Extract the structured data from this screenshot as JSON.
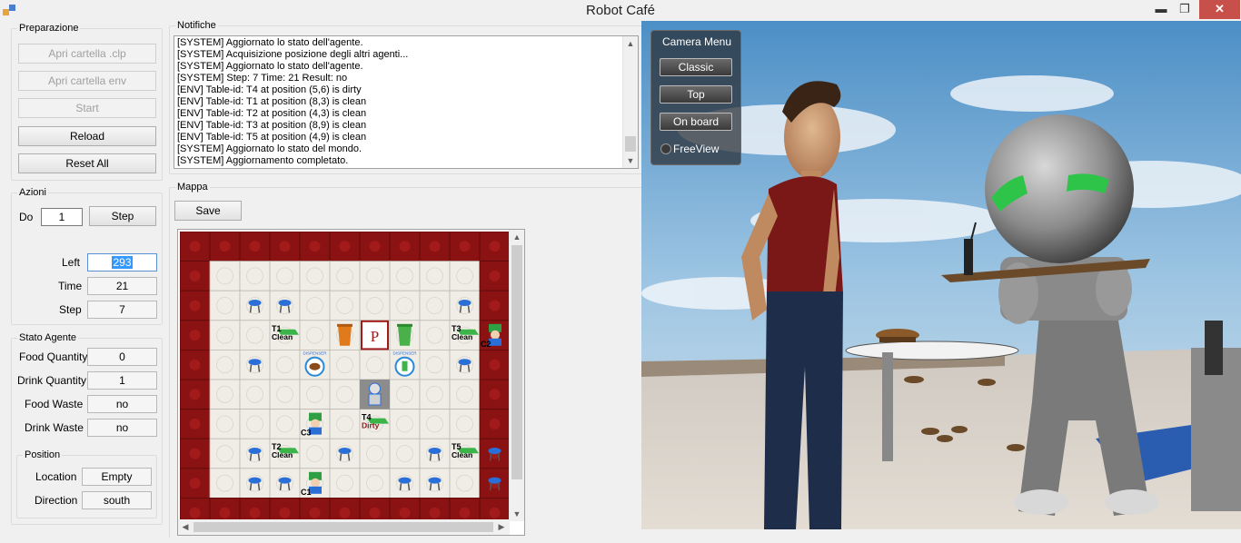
{
  "window": {
    "title": "Robot Café",
    "minimize": "▬",
    "maximize": "❐",
    "close": "✕"
  },
  "preparazione": {
    "legend": "Preparazione",
    "open_clp": "Apri cartella .clp",
    "open_env": "Apri cartella env",
    "start": "Start",
    "reload": "Reload",
    "reset": "Reset All"
  },
  "azioni": {
    "legend": "Azioni",
    "do_label": "Do",
    "do_value": "1",
    "step_button": "Step",
    "left_label": "Left",
    "left_value": "293",
    "time_label": "Time",
    "time_value": "21",
    "step_label": "Step",
    "step_value": "7"
  },
  "stato_agente": {
    "legend": "Stato Agente",
    "food_quantity_label": "Food Quantity",
    "food_quantity_value": "0",
    "drink_quantity_label": "Drink Quantity",
    "drink_quantity_value": "1",
    "food_waste_label": "Food Waste",
    "food_waste_value": "no",
    "drink_waste_label": "Drink Waste",
    "drink_waste_value": "no",
    "position": {
      "legend": "Position",
      "location_label": "Location",
      "location_value": "Empty",
      "direction_label": "Direction",
      "direction_value": "south"
    }
  },
  "notifiche": {
    "legend": "Notifiche",
    "lines": [
      "[SYSTEM] Aggiornato lo stato dell'agente.",
      "[SYSTEM] Acquisizione posizione degli altri agenti...",
      "[SYSTEM] Aggiornato lo stato dell'agente.",
      "[SYSTEM] Step: 7 Time: 21 Result: no",
      "[ENV] Table-id: T4 at position (5,6) is dirty",
      "[ENV] Table-id: T1 at position (8,3) is clean",
      "[ENV] Table-id: T2 at position (4,3) is clean",
      "[ENV] Table-id: T3 at position (8,9) is clean",
      "[ENV] Table-id: T5 at position (4,9) is clean",
      "[SYSTEM] Aggiornato lo stato del mondo.",
      "[SYSTEM] Aggiornamento completato."
    ]
  },
  "mappa": {
    "legend": "Mappa",
    "save": "Save",
    "tables": [
      {
        "id": "T1",
        "status": "Clean",
        "row": 3,
        "col": 3
      },
      {
        "id": "T3",
        "status": "Clean",
        "row": 3,
        "col": 9
      },
      {
        "id": "T4",
        "status": "Dirty",
        "row": 6,
        "col": 6
      },
      {
        "id": "T2",
        "status": "Clean",
        "row": 7,
        "col": 3
      },
      {
        "id": "T5",
        "status": "Clean",
        "row": 7,
        "col": 9
      }
    ],
    "customers": [
      {
        "id": "C2",
        "row": 3,
        "col": 10
      },
      {
        "id": "C3",
        "row": 6,
        "col": 4
      },
      {
        "id": "C1",
        "row": 8,
        "col": 4
      }
    ],
    "parking": {
      "label": "P",
      "row": 3,
      "col": 6
    },
    "dispensers": [
      {
        "label": "DISPENSER",
        "kind": "food",
        "row": 4,
        "col": 4
      },
      {
        "label": "DISPENSER",
        "kind": "drink",
        "row": 4,
        "col": 7
      }
    ],
    "trash_bins": [
      {
        "kind": "food",
        "row": 3,
        "col": 5
      },
      {
        "kind": "drink",
        "row": 3,
        "col": 7
      }
    ],
    "robot": {
      "row": 5,
      "col": 6
    },
    "chairs": [
      [
        2,
        2
      ],
      [
        2,
        3
      ],
      [
        2,
        9
      ],
      [
        4,
        2
      ],
      [
        4,
        9
      ],
      [
        7,
        2
      ],
      [
        7,
        5
      ],
      [
        7,
        8
      ],
      [
        7,
        10
      ],
      [
        8,
        2
      ],
      [
        8,
        3
      ],
      [
        8,
        7
      ],
      [
        8,
        8
      ],
      [
        8,
        10
      ]
    ]
  },
  "camera_menu": {
    "title": "Camera Menu",
    "classic": "Classic",
    "top": "Top",
    "on_board": "On board",
    "free_view": "FreeView"
  }
}
